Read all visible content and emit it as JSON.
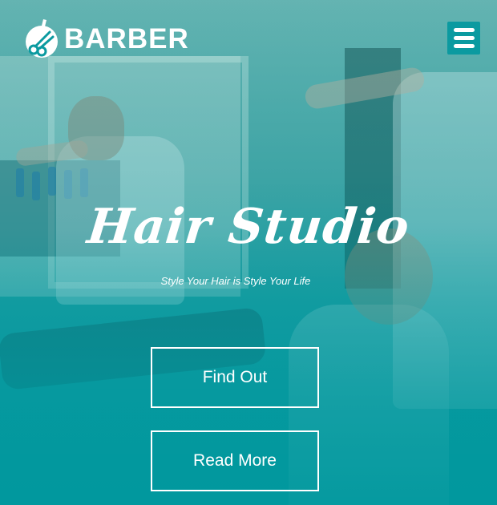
{
  "brand": {
    "name": "BARBER",
    "logo_icon": "scissors-head-icon"
  },
  "nav": {
    "menu_icon": "hamburger-menu-icon"
  },
  "hero": {
    "title": "Hair Studio",
    "subtitle": "Style Your Hair is Style Your Life",
    "primary_button": "Find Out",
    "secondary_button": "Read More"
  },
  "colors": {
    "accent": "#0b9aa0",
    "text": "#ffffff"
  }
}
